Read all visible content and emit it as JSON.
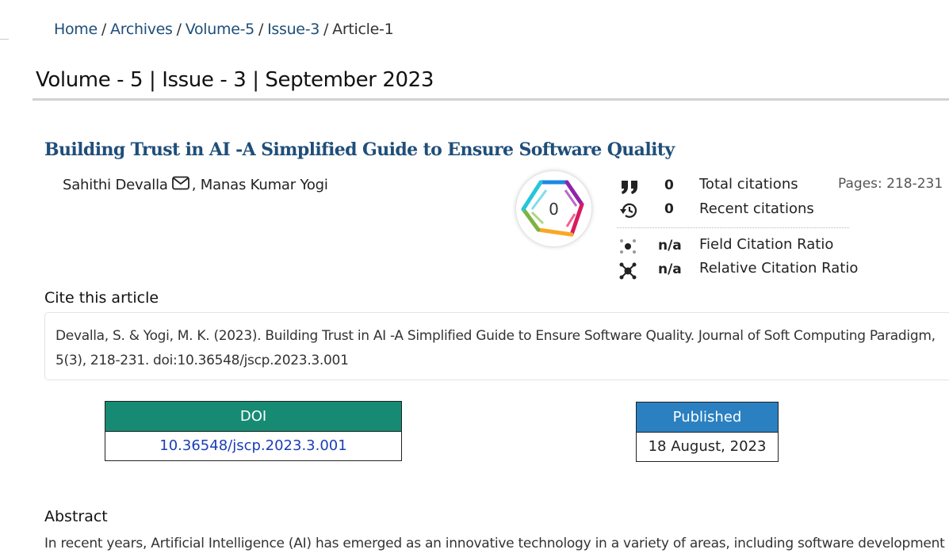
{
  "breadcrumb": {
    "home": "Home",
    "archives": "Archives",
    "volume": "Volume-5",
    "issue": "Issue-3",
    "current": "Article-1",
    "separator": "/"
  },
  "issue_heading": "Volume - 5 | Issue - 3 | September 2023",
  "article": {
    "title": "Building Trust in AI -A Simplified Guide to Ensure Software Quality",
    "author1": "Sahithi Devalla",
    "author2": ", Manas Kumar Yogi",
    "pages": "Pages: 218-231"
  },
  "dimensions_badge": {
    "value": "0"
  },
  "metrics": {
    "total_citations": {
      "value": "0",
      "label": "Total citations",
      "icon": "quote-icon"
    },
    "recent_citations": {
      "value": "0",
      "label": "Recent citations",
      "icon": "history-icon"
    },
    "field_citation_ratio": {
      "value": "n/a",
      "label": "Field Citation Ratio",
      "icon": "network-small-icon"
    },
    "relative_citation_ratio": {
      "value": "n/a",
      "label": "Relative Citation Ratio",
      "icon": "network-large-icon"
    }
  },
  "cite": {
    "heading": "Cite this article",
    "text": "Devalla, S. & Yogi, M. K. (2023). Building Trust in AI -A Simplified Guide to Ensure Software Quality. Journal of Soft Computing Paradigm, 5(3), 218-231. doi:10.36548/jscp.2023.3.001"
  },
  "doi": {
    "header": "DOI",
    "value": "10.36548/jscp.2023.3.001",
    "header_color": "#168a73"
  },
  "published": {
    "header": "Published",
    "value": "18 August, 2023",
    "header_color": "#2a80c0"
  },
  "abstract": {
    "heading": "Abstract",
    "text": "In recent years, Artificial Intelligence (AI) has emerged as an innovative technology in a variety of areas, including software development"
  },
  "colors": {
    "title_blue": "#1f4e79",
    "link_blue": "#1a3eb8"
  }
}
